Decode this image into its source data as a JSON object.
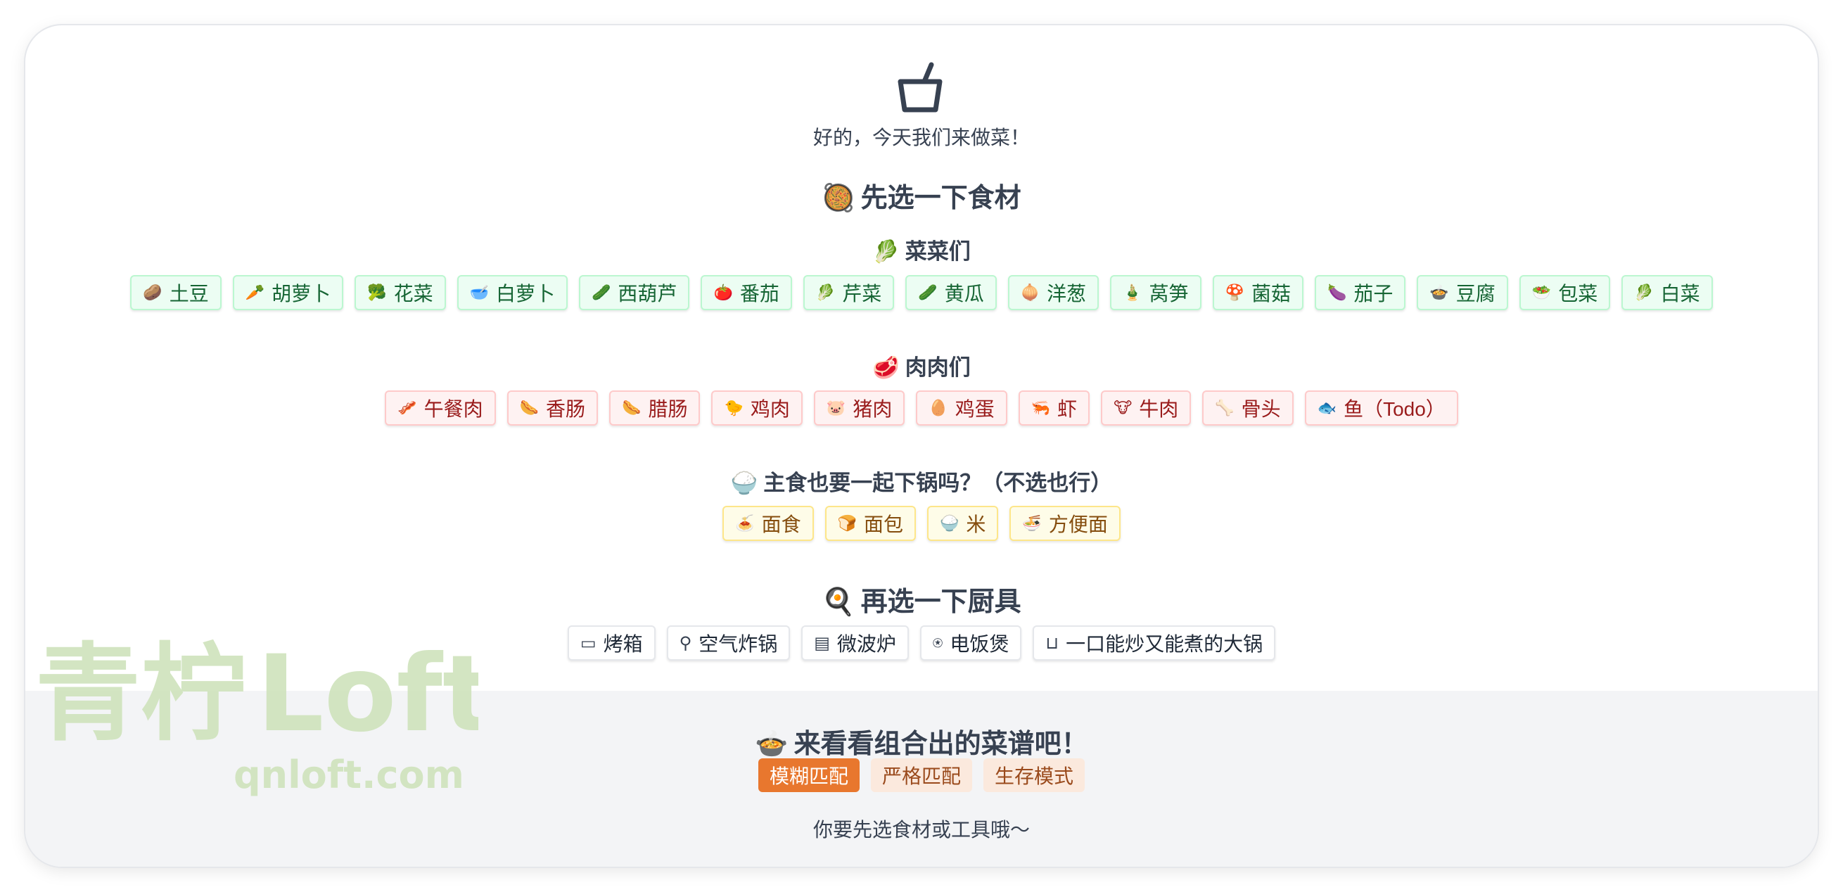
{
  "header": {
    "icon": "pot-icon",
    "subtitle": "好的，今天我们来做菜！"
  },
  "ingredients": {
    "title_emoji": "🥘",
    "title": "先选一下食材",
    "vegetables": {
      "emoji": "🥬",
      "title": "菜菜们",
      "items": [
        {
          "icon": "🥔",
          "label": "土豆"
        },
        {
          "icon": "🥕",
          "label": "胡萝卜"
        },
        {
          "icon": "🥦",
          "label": "花菜"
        },
        {
          "icon": "🥣",
          "label": "白萝卜"
        },
        {
          "icon": "🥒",
          "label": "西葫芦"
        },
        {
          "icon": "🍅",
          "label": "番茄"
        },
        {
          "icon": "🥬",
          "label": "芹菜"
        },
        {
          "icon": "🥒",
          "label": "黄瓜"
        },
        {
          "icon": "🧅",
          "label": "洋葱"
        },
        {
          "icon": "🎍",
          "label": "莴笋"
        },
        {
          "icon": "🍄",
          "label": "菌菇"
        },
        {
          "icon": "🍆",
          "label": "茄子"
        },
        {
          "icon": "🍲",
          "label": "豆腐"
        },
        {
          "icon": "🥗",
          "label": "包菜"
        },
        {
          "icon": "🥬",
          "label": "白菜"
        }
      ]
    },
    "meats": {
      "emoji": "🥩",
      "title": "肉肉们",
      "items": [
        {
          "icon": "🥓",
          "label": "午餐肉"
        },
        {
          "icon": "🌭",
          "label": "香肠"
        },
        {
          "icon": "🌭",
          "label": "腊肠"
        },
        {
          "icon": "🐤",
          "label": "鸡肉"
        },
        {
          "icon": "🐷",
          "label": "猪肉"
        },
        {
          "icon": "🥚",
          "label": "鸡蛋"
        },
        {
          "icon": "🦐",
          "label": "虾"
        },
        {
          "icon": "🐮",
          "label": "牛肉"
        },
        {
          "icon": "🦴",
          "label": "骨头"
        },
        {
          "icon": "🐟",
          "label": "鱼（Todo）"
        }
      ]
    },
    "staples": {
      "emoji": "🍚",
      "title": "主食也要一起下锅吗？（不选也行）",
      "items": [
        {
          "icon": "🍝",
          "label": "面食"
        },
        {
          "icon": "🍞",
          "label": "面包"
        },
        {
          "icon": "🍚",
          "label": "米"
        },
        {
          "icon": "🍜",
          "label": "方便面"
        }
      ]
    }
  },
  "tools": {
    "title_emoji": "🍳",
    "title": "再选一下厨具",
    "items": [
      {
        "icon": "▭",
        "label": "烤箱"
      },
      {
        "icon": "⚲",
        "label": "空气炸锅"
      },
      {
        "icon": "▤",
        "label": "微波炉"
      },
      {
        "icon": "⍟",
        "label": "电饭煲"
      },
      {
        "icon": "⊔",
        "label": "一口能炒又能煮的大锅"
      }
    ]
  },
  "recipes": {
    "title_emoji": "🍲",
    "title": "来看看组合出的菜谱吧！",
    "modes": [
      "模糊匹配",
      "严格匹配",
      "生存模式"
    ],
    "active_mode": "模糊匹配",
    "hint": "你要先选食材或工具哦～"
  },
  "watermark": {
    "text_cn": "青柠",
    "text_en": "Loft",
    "url": "qnloft.com"
  },
  "colors": {
    "veg_bg": "#ecfdf3",
    "meat_bg": "#fef2f2",
    "staple_bg": "#fefce8",
    "accent": "#e8772e"
  }
}
